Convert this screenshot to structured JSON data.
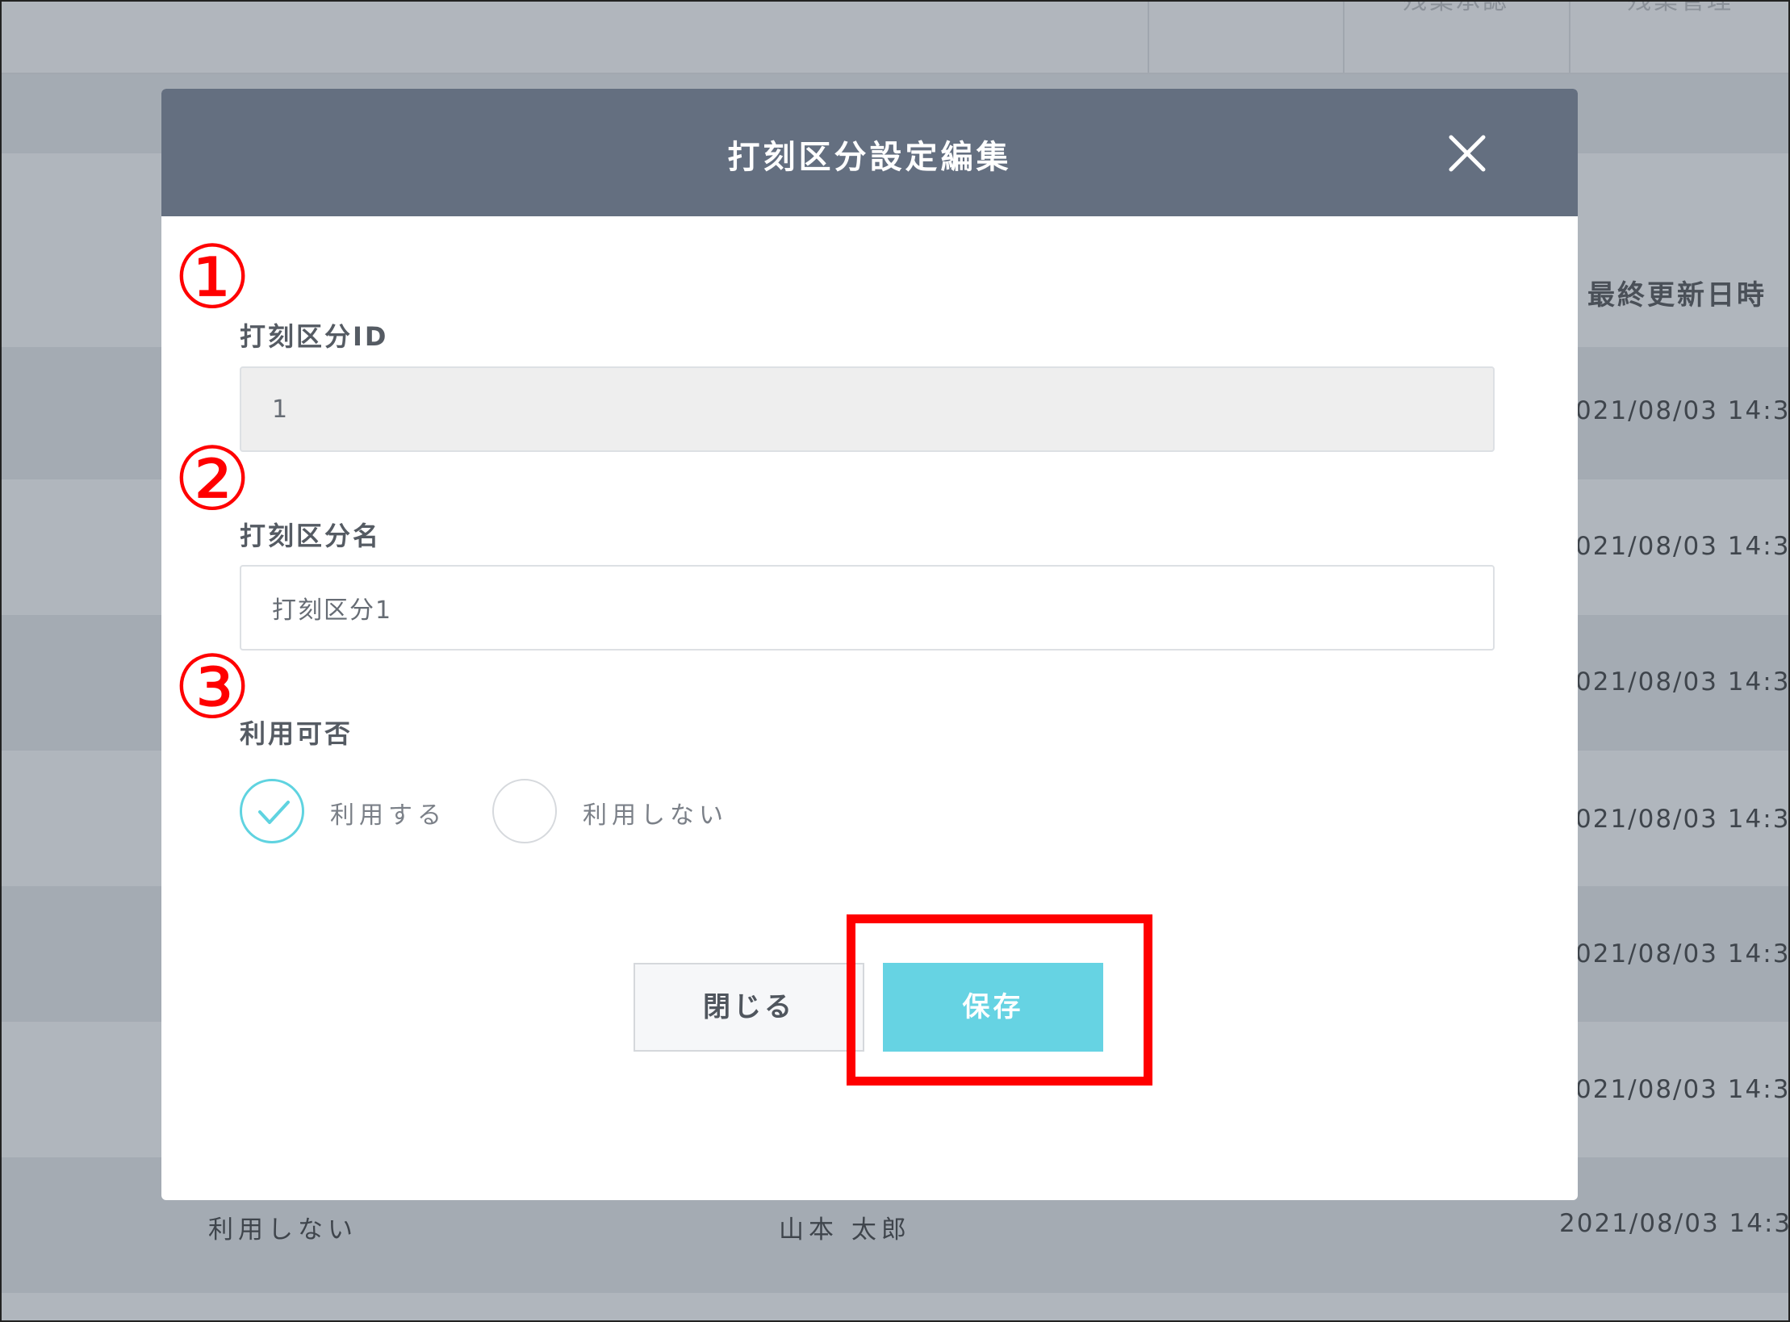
{
  "background": {
    "header_columns": [
      "ー",
      "残業承認",
      "残業管理"
    ],
    "last_updated_header": "最終更新日時",
    "row_dates": [
      "021/08/03 14:3",
      "021/08/03 14:3",
      "021/08/03 14:3",
      "021/08/03 14:3",
      "021/08/03 14:3",
      "021/08/03 14:3"
    ],
    "last_row": {
      "status": "利用しない",
      "user": "山本 太郎",
      "date": "2021/08/03 14:3"
    }
  },
  "modal": {
    "title": "打刻区分設定編集",
    "close_icon": "close-icon",
    "markers": [
      "①",
      "②",
      "③"
    ],
    "fields": {
      "id": {
        "label": "打刻区分ID",
        "value": "1"
      },
      "name": {
        "label": "打刻区分名",
        "value": "打刻区分1"
      },
      "availability": {
        "label": "利用可否",
        "options": [
          "利用する",
          "利用しない"
        ],
        "selected": "利用する"
      }
    },
    "buttons": {
      "close_label": "閉じる",
      "save_label": "保存"
    }
  },
  "colors": {
    "header_bg": "#646f80",
    "accent": "#66d3e3",
    "annotation_red": "#ff0000",
    "overlay": "#aab0b8"
  }
}
